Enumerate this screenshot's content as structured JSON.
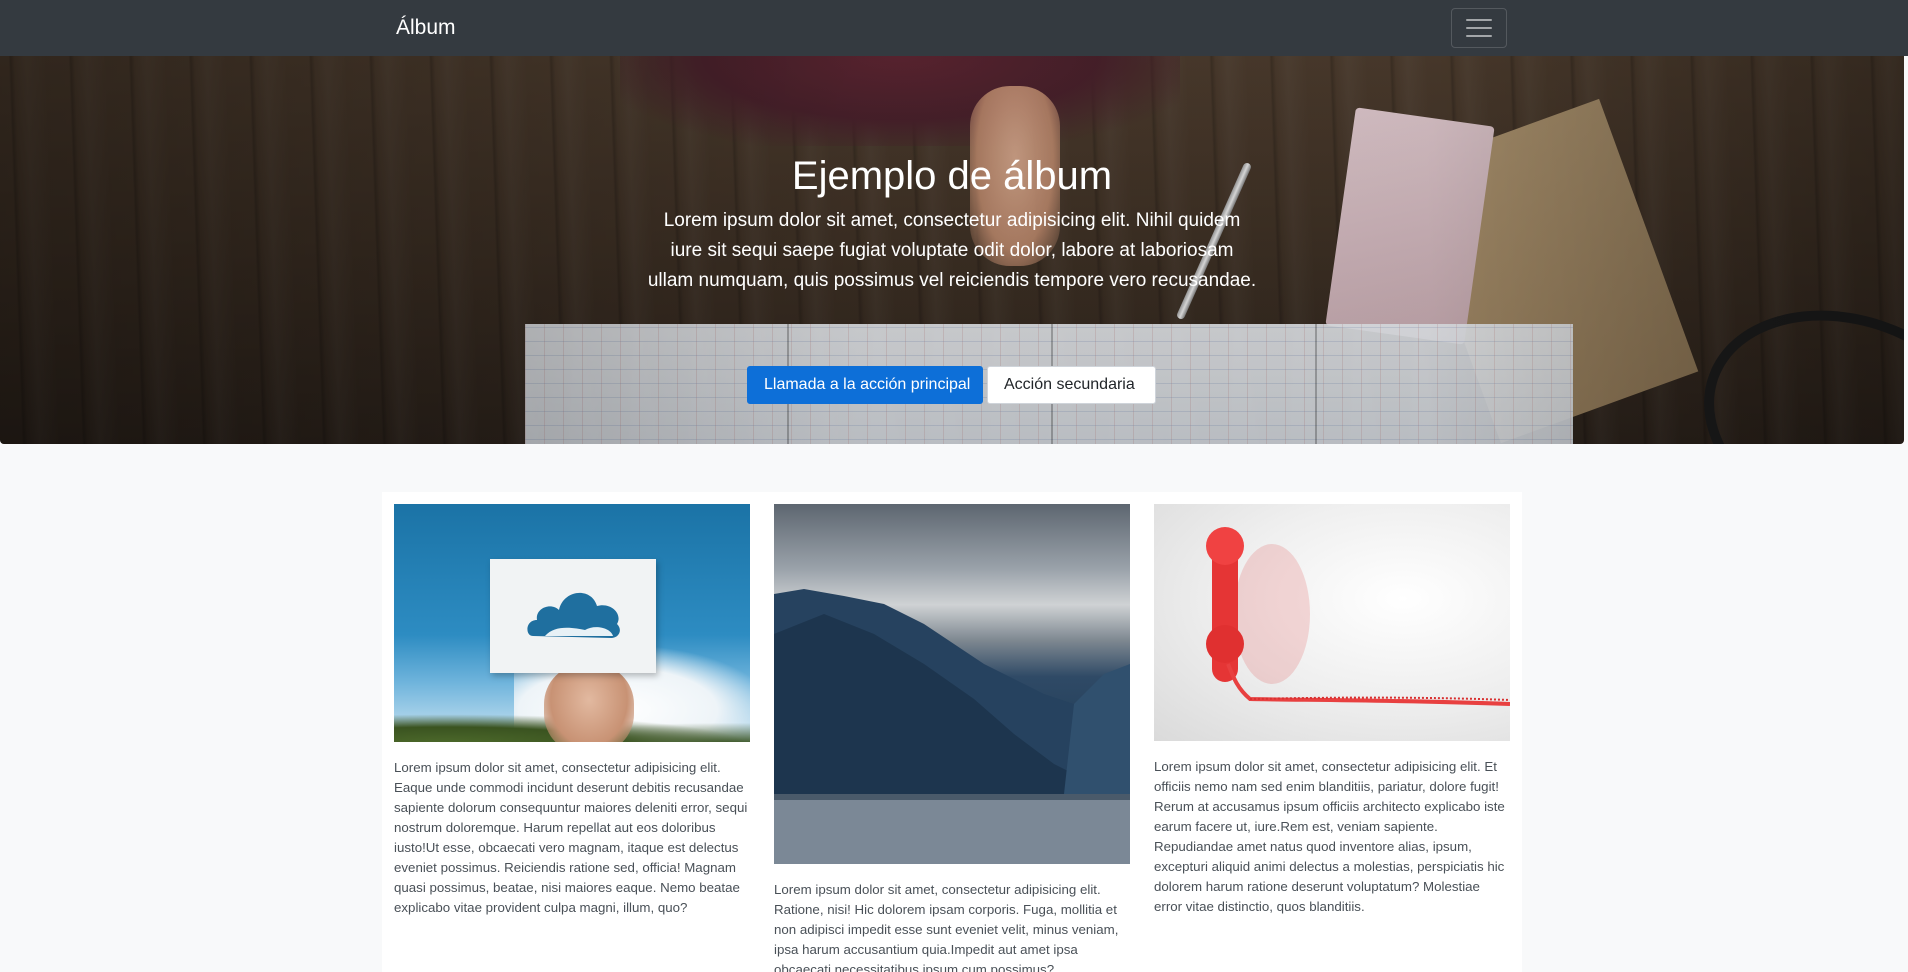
{
  "navbar": {
    "brand": "Álbum",
    "toggler_icon": "hamburger-menu-icon"
  },
  "hero": {
    "title": "Ejemplo de álbum",
    "lead": "Lorem ipsum dolor sit amet, consectetur adipisicing elit. Nihil quidem iure sit sequi saepe fugiat voluptate odit dolor, labore at laboriosam ullam numquam, quis possimus vel reiciendis tempore vero recusandae.",
    "primary_button": "Llamada a la acción principal",
    "secondary_button": "Acción secundaria"
  },
  "cards": [
    {
      "image": "cloud-cutout-photo",
      "text": "Lorem ipsum dolor sit amet, consectetur adipisicing elit. Eaque unde commodi incidunt deserunt debitis recusandae sapiente dolorum consequuntur maiores deleniti error, sequi nostrum doloremque. Harum repellat aut eos doloribus iusto!Ut esse, obcaecati vero magnam, itaque est delectus eveniet possimus. Reiciendis ratione sed, officia! Magnam quasi possimus, beatae, nisi maiores eaque. Nemo beatae explicabo vitae provident culpa magni, illum, quo?"
    },
    {
      "image": "mountain-fjord-photo",
      "text": "Lorem ipsum dolor sit amet, consectetur adipisicing elit. Ratione, nisi! Hic dolorem ipsam corporis. Fuga, mollitia et non adipisci impedit esse sunt eveniet velit, minus veniam, ipsa harum accusantium quia.Impedit aut amet ipsa obcaecati necessitatibus ipsum cum possimus?"
    },
    {
      "image": "red-telephone-photo",
      "text": "Lorem ipsum dolor sit amet, consectetur adipisicing elit. Et officiis nemo nam sed enim blanditiis, pariatur, dolore fugit! Rerum at accusamus ipsum officiis architecto explicabo iste earum facere ut, iure.Rem est, veniam sapiente. Repudiandae amet natus quod inventore alias, ipsum, excepturi aliquid animi delectus a molestias, perspiciatis hic dolorem harum ratione deserunt voluptatum? Molestiae error vitae distinctio, quos blanditiis."
    }
  ],
  "colors": {
    "navbar_bg": "#343a40",
    "primary": "#0d6fd8",
    "page_bg": "#f8f9fa",
    "album_bg": "#ffffff"
  }
}
